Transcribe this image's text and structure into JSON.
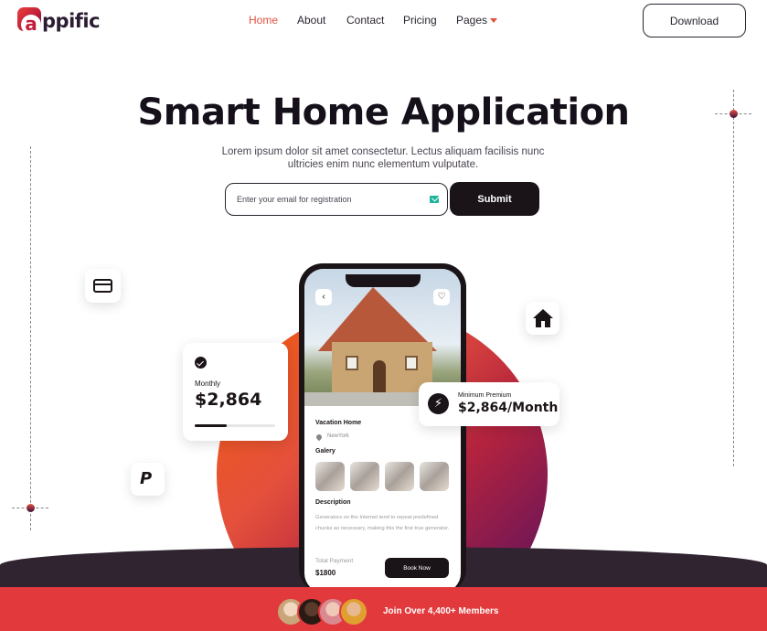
{
  "header": {
    "logo_text": "ppific",
    "logo_mark_letter": "a",
    "nav": [
      {
        "label": "Home",
        "active": true
      },
      {
        "label": "About",
        "active": false
      },
      {
        "label": "Contact",
        "active": false
      },
      {
        "label": "Pricing",
        "active": false
      },
      {
        "label": "Pages",
        "active": false
      }
    ],
    "download_label": "Download"
  },
  "hero": {
    "title": "Smart Home Application",
    "subtitle": "Lorem ipsum dolor sit amet consectetur. Lectus aliquam facilisis nunc ultricies enim nunc elementum vulputate.",
    "email_placeholder": "Enter your email for registration",
    "email_value": "",
    "submit_label": "Submit"
  },
  "phone": {
    "card_title": "Vacation Home",
    "location": "NewYork",
    "gallery_label": "Galery",
    "description_label": "Description",
    "description_text": "Generators on the Internet tend to repeat predefined chunks as necessary, making this the first true generator.",
    "payment_label": "Total Payment",
    "payment_value": "$1800",
    "book_label": "Book Now",
    "back_icon": "‹",
    "heart_icon": "♡"
  },
  "cards": {
    "monthly_label": "Monthly",
    "monthly_value": "$2,864",
    "monthly_progress": 0.4,
    "premium_label": "Minimum Premium",
    "premium_value": "$2,864/Month",
    "bolt_glyph": "⚡",
    "paypal_glyph": "P"
  },
  "footer": {
    "members_text": "Join Over 4,400+ Members"
  },
  "colors": {
    "accent": "#e4503c",
    "dark": "#1a1418",
    "footer_red": "#e1393c",
    "band_dark": "#2f2430"
  },
  "icons": [
    "credit-card-icon",
    "home-icon",
    "paypal-icon",
    "check-icon",
    "bolt-icon",
    "mail-icon",
    "location-icon",
    "chevron-down-icon",
    "back-icon",
    "heart-icon"
  ]
}
